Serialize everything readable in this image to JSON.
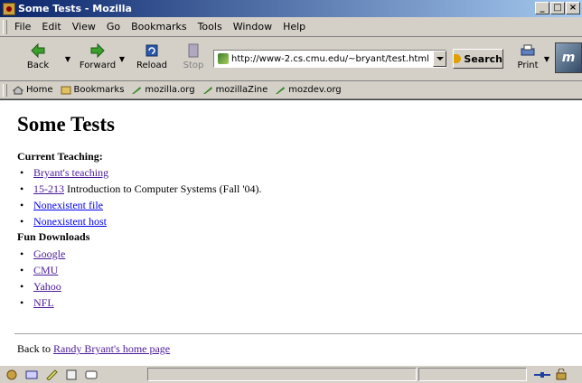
{
  "window": {
    "title": "Some Tests - Mozilla"
  },
  "menu": [
    "File",
    "Edit",
    "View",
    "Go",
    "Bookmarks",
    "Tools",
    "Window",
    "Help"
  ],
  "nav": {
    "back": "Back",
    "forward": "Forward",
    "reload": "Reload",
    "stop": "Stop",
    "url": "http://www-2.cs.cmu.edu/~bryant/test.html",
    "search": "Search",
    "print": "Print"
  },
  "personal_toolbar": [
    "Home",
    "Bookmarks",
    "mozilla.org",
    "mozillaZine",
    "mozdev.org"
  ],
  "page": {
    "heading": "Some Tests",
    "teaching_heading": "Current Teaching:",
    "teaching": {
      "link1": "Bryant's teaching",
      "link2": "15-213",
      "link2_suffix": " Introduction to Computer Systems (Fall '04).",
      "link3": "Nonexistent file",
      "link4": "Nonexistent host"
    },
    "downloads_heading": "Fun Downloads",
    "downloads": [
      "Google",
      "CMU",
      "Yahoo",
      "NFL"
    ],
    "back_prefix": "Back to ",
    "back_link": "Randy Bryant's home page"
  },
  "status": {
    "text": ""
  },
  "colors": {
    "titlebar": "#0a246a",
    "link_visited": "#4b1a9a",
    "link": "#0000ee"
  }
}
